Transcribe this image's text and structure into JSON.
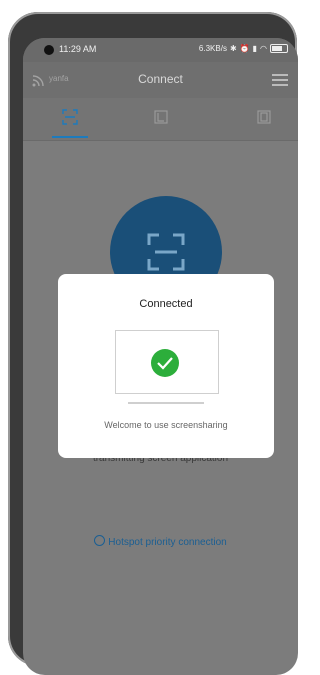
{
  "status_bar": {
    "time": "11:29 AM",
    "network": "6.3KB/s",
    "icons": [
      "bluetooth-icon",
      "alarm-icon",
      "signal-icon",
      "wifi-icon",
      "battery-icon"
    ]
  },
  "app_bar": {
    "ssid": "yanfa",
    "title": "Connect",
    "menu_icon": "menu-icon"
  },
  "tabs": [
    {
      "icon": "scan-icon",
      "active": true
    },
    {
      "icon": "screen-cast-icon",
      "active": false
    },
    {
      "icon": "device-icon",
      "active": false
    }
  ],
  "background": {
    "partial_text": "transmitting screen application",
    "hotspot_label": "Hotspot priority connection"
  },
  "dialog": {
    "title": "Connected",
    "message": "Welcome to use screensharing"
  },
  "colors": {
    "accent": "#1d7bbd",
    "success": "#2cae3b",
    "circle": "#1a4f78"
  }
}
